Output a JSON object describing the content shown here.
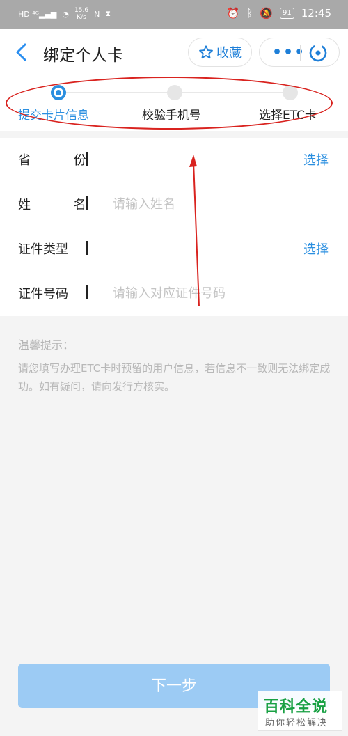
{
  "statusbar": {
    "left_icons": "HD ⁴ᴳ▂▄▆",
    "speed": "15.6\nK/s",
    "nfc": "N",
    "time": "12:45",
    "battery": "91"
  },
  "header": {
    "title": "绑定个人卡",
    "fav_label": "收藏",
    "more_label": "•••"
  },
  "steps": [
    {
      "label": "提交卡片信息"
    },
    {
      "label": "校验手机号"
    },
    {
      "label": "选择ETC卡"
    }
  ],
  "form": {
    "province": {
      "label": "省 份",
      "select": "选择"
    },
    "name": {
      "label": "姓 名",
      "placeholder": "请输入姓名"
    },
    "id_type": {
      "label": "证件类型",
      "select": "选择"
    },
    "id_number": {
      "label": "证件号码",
      "placeholder": "请输入对应证件号码"
    }
  },
  "tips": {
    "title": "温馨提示：",
    "body": "请您填写办理ETC卡时预留的用户信息，若信息不一致则无法绑定成功。如有疑问，请向发行方核实。"
  },
  "next_button": "下一步",
  "watermark": {
    "main": "百科全说",
    "sub": "助你轻松解决"
  },
  "colors": {
    "accent": "#2b8fe0",
    "annotation": "#d9231f",
    "button_disabled": "#9ccbf4"
  }
}
